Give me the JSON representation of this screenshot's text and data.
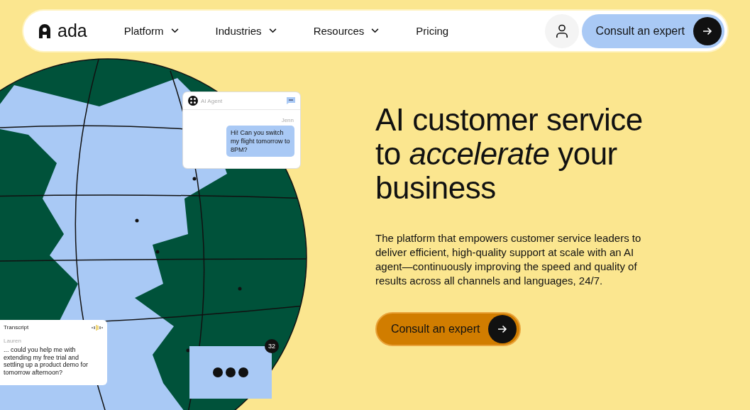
{
  "nav": {
    "logo": "ada",
    "items": [
      {
        "label": "Platform",
        "has_menu": true
      },
      {
        "label": "Industries",
        "has_menu": true
      },
      {
        "label": "Resources",
        "has_menu": true
      },
      {
        "label": "Pricing",
        "has_menu": false
      }
    ],
    "cta": "Consult an expert"
  },
  "hero": {
    "heading": "AI customer service to *accelerate* your business",
    "text": "The platform that empowers customer service leaders to deliver efficient, high-quality support at scale with an AI agent—continuously improving the speed and quality of results across all channels and languages, 24/7.",
    "button": "Consult an expert"
  },
  "agent_card": {
    "title": "AI Agent",
    "sender": "Jenn",
    "message": "Hi! Can you switch my flight tomorrow to 8PM?"
  },
  "transcript_card": {
    "title": "Transcript",
    "sender": "Lauren",
    "message": "... could you help me with extending my free trial and settling up a product demo for tomorrow afternoon?"
  },
  "chat_bubble": {
    "badge": "32"
  }
}
